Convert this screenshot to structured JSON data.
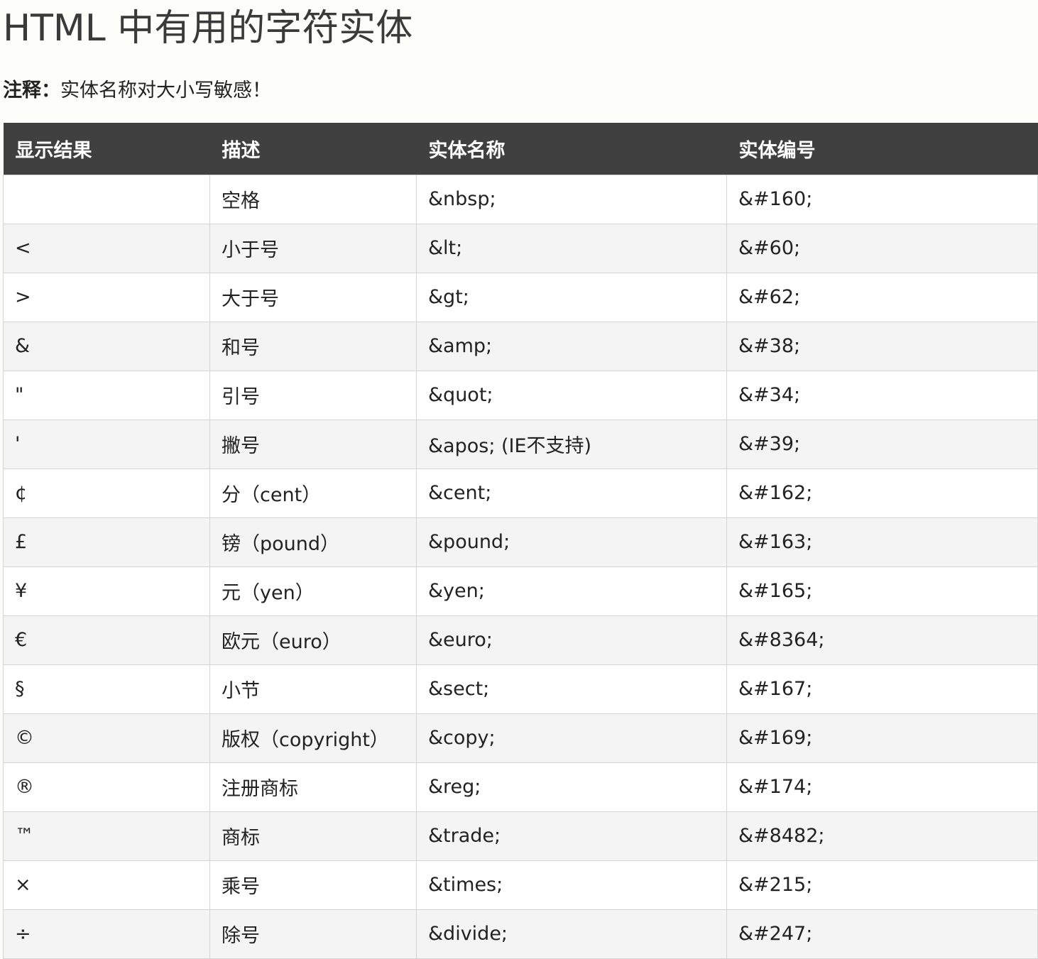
{
  "page": {
    "title": "HTML 中有用的字符实体",
    "note_label": "注释：",
    "note_text": "实体名称对大小写敏感！"
  },
  "table": {
    "headers": [
      "显示结果",
      "描述",
      "实体名称",
      "实体编号"
    ],
    "rows": [
      {
        "display": "",
        "description": "空格",
        "entity_name": "&nbsp;",
        "entity_number": "&#160;"
      },
      {
        "display": "<",
        "description": "小于号",
        "entity_name": "&lt;",
        "entity_number": "&#60;"
      },
      {
        "display": ">",
        "description": "大于号",
        "entity_name": "&gt;",
        "entity_number": "&#62;"
      },
      {
        "display": "&",
        "description": "和号",
        "entity_name": "&amp;",
        "entity_number": "&#38;"
      },
      {
        "display": "\"",
        "description": "引号",
        "entity_name": "&quot;",
        "entity_number": "&#34;"
      },
      {
        "display": "'",
        "description": "撇号",
        "entity_name": "&apos; (IE不支持)",
        "entity_number": "&#39;"
      },
      {
        "display": "¢",
        "description": "分（cent）",
        "entity_name": "&cent;",
        "entity_number": "&#162;"
      },
      {
        "display": "£",
        "description": "镑（pound）",
        "entity_name": "&pound;",
        "entity_number": "&#163;"
      },
      {
        "display": "¥",
        "description": "元（yen）",
        "entity_name": "&yen;",
        "entity_number": "&#165;"
      },
      {
        "display": "€",
        "description": "欧元（euro）",
        "entity_name": "&euro;",
        "entity_number": "&#8364;"
      },
      {
        "display": "§",
        "description": "小节",
        "entity_name": "&sect;",
        "entity_number": "&#167;"
      },
      {
        "display": "©",
        "description": "版权（copyright）",
        "entity_name": "&copy;",
        "entity_number": "&#169;"
      },
      {
        "display": "®",
        "description": "注册商标",
        "entity_name": "&reg;",
        "entity_number": "&#174;"
      },
      {
        "display": "™",
        "description": "商标",
        "entity_name": "&trade;",
        "entity_number": "&#8482;"
      },
      {
        "display": "×",
        "description": "乘号",
        "entity_name": "&times;",
        "entity_number": "&#215;"
      },
      {
        "display": "÷",
        "description": "除号",
        "entity_name": "&divide;",
        "entity_number": "&#247;"
      }
    ]
  }
}
